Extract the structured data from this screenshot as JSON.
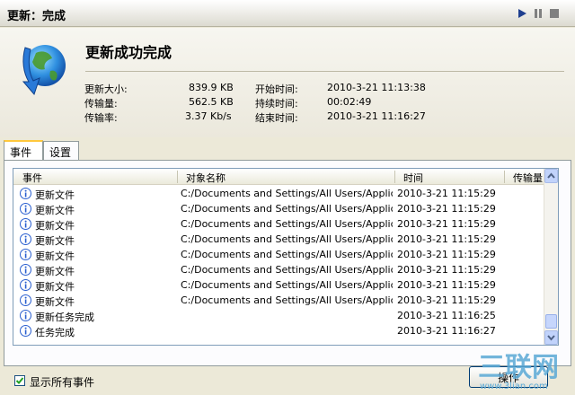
{
  "window": {
    "title": "更新：完成",
    "controls": [
      "play-icon",
      "pause-icon",
      "stop-icon"
    ]
  },
  "header": {
    "status_title": "更新成功完成",
    "logo_icon": "globe-arrow-icon",
    "stats": {
      "update_size_label": "更新大小:",
      "update_size_value": "839.9 KB",
      "transferred_label": "传输量:",
      "transferred_value": "562.5 KB",
      "rate_label": "传输率:",
      "rate_value": "3.37 Kb/s",
      "start_label": "开始时间:",
      "start_value": "2010-3-21 11:13:38",
      "duration_label": "持续时间:",
      "duration_value": "00:02:49",
      "end_label": "结束时间:",
      "end_value": "2010-3-21 11:16:27"
    }
  },
  "tabs": [
    {
      "label": "事件",
      "active": true
    },
    {
      "label": "设置",
      "active": false
    }
  ],
  "events_table": {
    "columns": [
      "事件",
      "对象名称",
      "时间",
      "传输量"
    ],
    "rows": [
      {
        "icon": "info-icon",
        "event": "更新文件",
        "object": "C:/Documents and Settings/All Users/Applicatio...",
        "time": "2010-3-21 11:15:29"
      },
      {
        "icon": "info-icon",
        "event": "更新文件",
        "object": "C:/Documents and Settings/All Users/Applicatio...",
        "time": "2010-3-21 11:15:29"
      },
      {
        "icon": "info-icon",
        "event": "更新文件",
        "object": "C:/Documents and Settings/All Users/Applicatio...",
        "time": "2010-3-21 11:15:29"
      },
      {
        "icon": "info-icon",
        "event": "更新文件",
        "object": "C:/Documents and Settings/All Users/Applicatio...",
        "time": "2010-3-21 11:15:29"
      },
      {
        "icon": "info-icon",
        "event": "更新文件",
        "object": "C:/Documents and Settings/All Users/Applicatio...",
        "time": "2010-3-21 11:15:29"
      },
      {
        "icon": "info-icon",
        "event": "更新文件",
        "object": "C:/Documents and Settings/All Users/Applicatio...",
        "time": "2010-3-21 11:15:29"
      },
      {
        "icon": "info-icon",
        "event": "更新文件",
        "object": "C:/Documents and Settings/All Users/Applicatio...",
        "time": "2010-3-21 11:15:29"
      },
      {
        "icon": "info-icon",
        "event": "更新文件",
        "object": "C:/Documents and Settings/All Users/Applicatio...",
        "time": "2010-3-21 11:15:29"
      },
      {
        "icon": "info-icon",
        "event": "更新任务完成",
        "object": "",
        "time": "2010-3-21 11:16:25"
      },
      {
        "icon": "info-icon",
        "event": "任务完成",
        "object": "",
        "time": "2010-3-21 11:16:27"
      }
    ]
  },
  "footer": {
    "show_all_events_label": "显示所有事件",
    "show_all_events_checked": true,
    "action_button_label": "操作"
  },
  "watermark": {
    "text": "三联网",
    "url": "www.3lian.com"
  },
  "colors": {
    "accent_blue": "#3a6ee8",
    "logo_green": "#4a9a2c",
    "info_blue": "#2a5fcf",
    "watermark_blue": "#5aa9d6"
  }
}
